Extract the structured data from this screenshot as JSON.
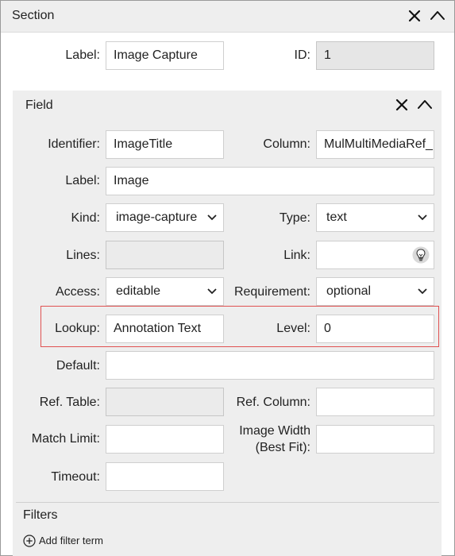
{
  "section": {
    "title": "Section",
    "label_caption": "Label:",
    "label_value": "Image Capture",
    "id_caption": "ID:",
    "id_value": "1"
  },
  "field": {
    "title": "Field",
    "identifier": {
      "caption": "Identifier:",
      "value": "ImageTitle"
    },
    "column": {
      "caption": "Column:",
      "value": "MulMultiMediaRef_"
    },
    "label": {
      "caption": "Label:",
      "value": "Image"
    },
    "kind": {
      "caption": "Kind:",
      "value": "image-capture"
    },
    "type": {
      "caption": "Type:",
      "value": "text"
    },
    "lines": {
      "caption": "Lines:",
      "value": ""
    },
    "link": {
      "caption": "Link:",
      "value": "",
      "icon": "lightbulb-icon"
    },
    "access": {
      "caption": "Access:",
      "value": "editable"
    },
    "requirement": {
      "caption": "Requirement:",
      "value": "optional"
    },
    "lookup": {
      "caption": "Lookup:",
      "value": "Annotation Text"
    },
    "level": {
      "caption": "Level:",
      "value": "0"
    },
    "default": {
      "caption": "Default:",
      "value": ""
    },
    "ref_table": {
      "caption": "Ref. Table:",
      "value": ""
    },
    "ref_column": {
      "caption": "Ref. Column:",
      "value": ""
    },
    "match_limit": {
      "caption": "Match Limit:",
      "value": ""
    },
    "image_width": {
      "caption": "Image Width (Best Fit):",
      "value": ""
    },
    "timeout": {
      "caption": "Timeout:",
      "value": ""
    }
  },
  "filters": {
    "title": "Filters",
    "add_label": "Add filter term"
  },
  "colors": {
    "header_bg": "#eeeeee",
    "panel_bg": "#eeeeee",
    "highlight_border": "#e05252",
    "disabled_bg": "#ebebeb"
  }
}
